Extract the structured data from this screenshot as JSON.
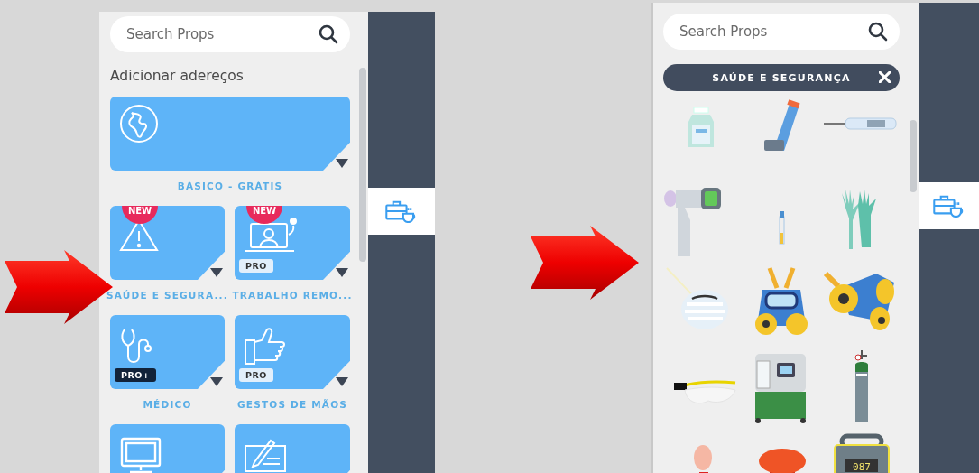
{
  "before": {
    "search": {
      "placeholder": "Search Props"
    },
    "heading": "Adicionar adereços",
    "categories": [
      {
        "kind": "wide",
        "label": "BÁSICO - GRÁTIS"
      },
      {
        "kind": "tile",
        "label": "SAÚDE E SEGURA...",
        "ribbon": "NEW"
      },
      {
        "kind": "tile",
        "label": "TRABALHO REMO...",
        "ribbon": "NEW",
        "tier": {
          "kind": "pro",
          "text": "PRO"
        }
      },
      {
        "kind": "tile",
        "label": "MÉDICO",
        "tier": {
          "kind": "pro_plus",
          "text": "PRO+"
        }
      },
      {
        "kind": "tile",
        "label": "GESTOS DE MÃOS",
        "tier": {
          "kind": "pro",
          "text": "PRO"
        }
      },
      {
        "kind": "tile"
      },
      {
        "kind": "tile"
      }
    ],
    "rail_tab": {
      "selected": true
    }
  },
  "after": {
    "search": {
      "placeholder": "Search Props"
    },
    "filter": {
      "label": "SAÚDE E SEGURANÇA"
    },
    "props_display_reading": "087",
    "rail_tab": {
      "selected": true
    }
  }
}
